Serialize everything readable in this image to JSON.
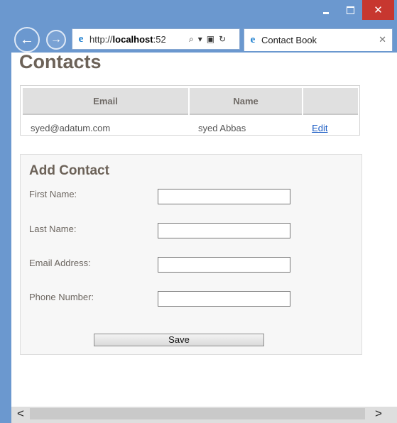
{
  "browser": {
    "url_prefix": "http://",
    "url_host": "localhost",
    "url_suffix": ":52",
    "tab_title": "Contact Book",
    "controls": {
      "minimize": "–",
      "maximize": "□",
      "close": "✕"
    }
  },
  "page": {
    "title": "Contacts",
    "table": {
      "headers": [
        "Email",
        "Name",
        ""
      ],
      "rows": [
        {
          "email": "syed@adatum.com",
          "name": "syed Abbas",
          "action": "Edit"
        }
      ]
    },
    "form": {
      "title": "Add Contact",
      "fields": [
        {
          "label": "First Name:",
          "value": ""
        },
        {
          "label": "Last Name:",
          "value": ""
        },
        {
          "label": "Email Address:",
          "value": ""
        },
        {
          "label": "Phone Number:",
          "value": ""
        }
      ],
      "save_label": "Save"
    }
  },
  "scrollbar": {
    "left_arrow": "<",
    "right_arrow": ">"
  }
}
